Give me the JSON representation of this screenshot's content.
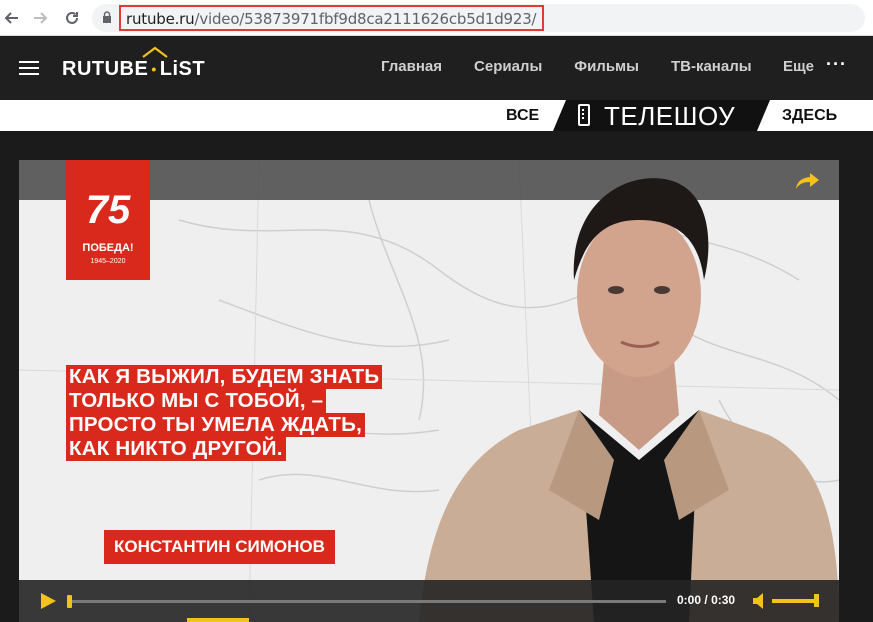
{
  "browser": {
    "url_host": "rutube.ru",
    "url_path": "/video/53873971fbf9d8ca2111626cb5d1d923/",
    "back_icon": "back-arrow-icon",
    "forward_icon": "forward-arrow-icon",
    "reload_icon": "reload-icon",
    "lock_icon": "lock-icon"
  },
  "header": {
    "logo_main": "RUTUBE",
    "logo_sub": "LiST",
    "nav": [
      "Главная",
      "Сериалы",
      "Фильмы",
      "ТВ-каналы"
    ],
    "more_label": "Еще",
    "dots_label": "···",
    "accent_color": "#f4c21b"
  },
  "banner": {
    "left_word": "ВСЕ",
    "title": "ТЕЛЕШОУ",
    "right_word": "ЗДЕСЬ"
  },
  "video": {
    "victory": {
      "number": "75",
      "label": "ПОБЕДА!",
      "years": "1945–2020"
    },
    "quote_lines": [
      "КАК Я ВЫЖИЛ, БУДЕМ ЗНАТЬ",
      "ТОЛЬКО МЫ С ТОБОЙ, –",
      "ПРОСТО ТЫ УМЕЛА ЖДАТЬ,",
      "КАК НИКТО ДРУГОЙ."
    ],
    "author": "КОНСТАНТИН СИМОНОВ",
    "quote_color": "#d8291c"
  },
  "player": {
    "current_time": "0:00",
    "separator": "/",
    "duration": "0:30",
    "progress_fraction": 0.0,
    "volume_fraction": 1.0
  }
}
